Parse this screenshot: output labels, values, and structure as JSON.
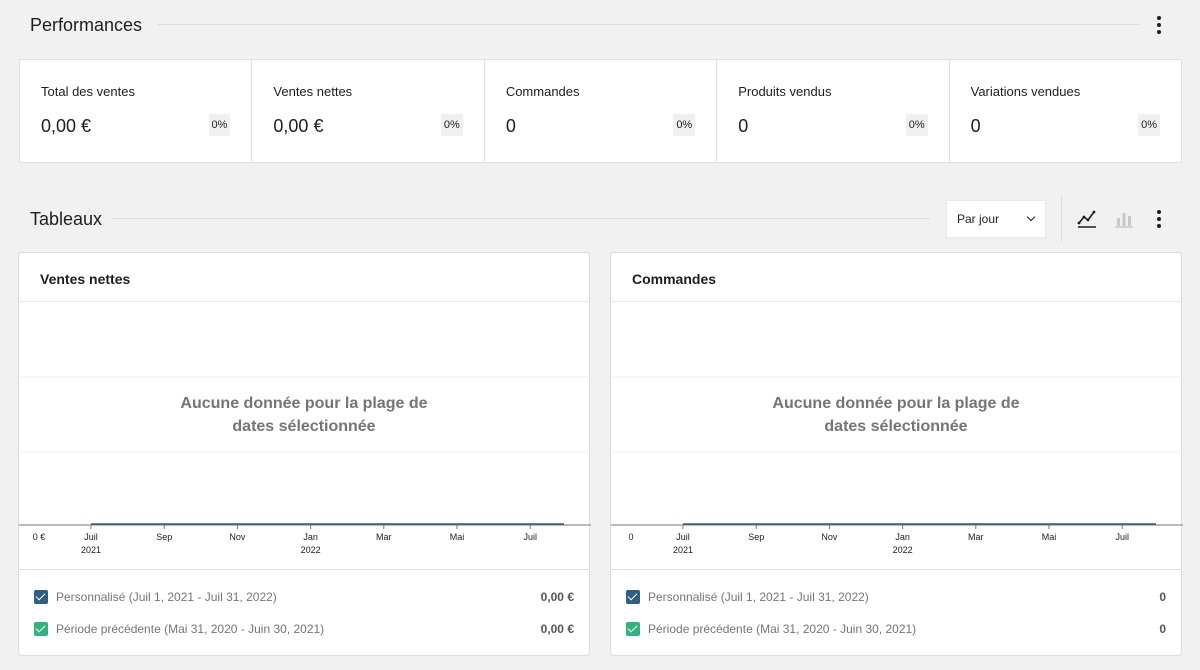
{
  "performance": {
    "title": "Performances",
    "cards": [
      {
        "label": "Total des ventes",
        "value": "0,00 €",
        "delta": "0%"
      },
      {
        "label": "Ventes nettes",
        "value": "0,00 €",
        "delta": "0%"
      },
      {
        "label": "Commandes",
        "value": "0",
        "delta": "0%"
      },
      {
        "label": "Produits vendus",
        "value": "0",
        "delta": "0%"
      },
      {
        "label": "Variations vendues",
        "value": "0",
        "delta": "0%"
      }
    ]
  },
  "charts": {
    "title": "Tableaux",
    "interval": "Par jour",
    "icons": {
      "line": "line-chart-icon",
      "bar": "bar-chart-icon",
      "menu": "more-vertical-icon"
    },
    "empty_message_line1": "Aucune donnée pour la plage de",
    "empty_message_line2": "dates sélectionnée",
    "axis_ticks": [
      {
        "month": "Juil",
        "year": "2021"
      },
      {
        "month": "Sep",
        "year": ""
      },
      {
        "month": "Nov",
        "year": ""
      },
      {
        "month": "Jan",
        "year": "2022"
      },
      {
        "month": "Mar",
        "year": ""
      },
      {
        "month": "Mai",
        "year": ""
      },
      {
        "month": "Juil",
        "year": ""
      }
    ],
    "colors": {
      "primary": "#2f5d84",
      "previous": "#2fb47c",
      "axis": "#757575"
    },
    "items": [
      {
        "title": "Ventes nettes",
        "y_label": "0 €",
        "legend": [
          {
            "label": "Personnalisé (Juil 1, 2021 - Juil 31, 2022)",
            "value": "0,00 €"
          },
          {
            "label": "Période précédente (Mai 31, 2020 - Juin 30, 2021)",
            "value": "0,00 €"
          }
        ]
      },
      {
        "title": "Commandes",
        "y_label": "0",
        "legend": [
          {
            "label": "Personnalisé (Juil 1, 2021 - Juil 31, 2022)",
            "value": "0"
          },
          {
            "label": "Période précédente (Mai 31, 2020 - Juin 30, 2021)",
            "value": "0"
          }
        ]
      }
    ]
  }
}
